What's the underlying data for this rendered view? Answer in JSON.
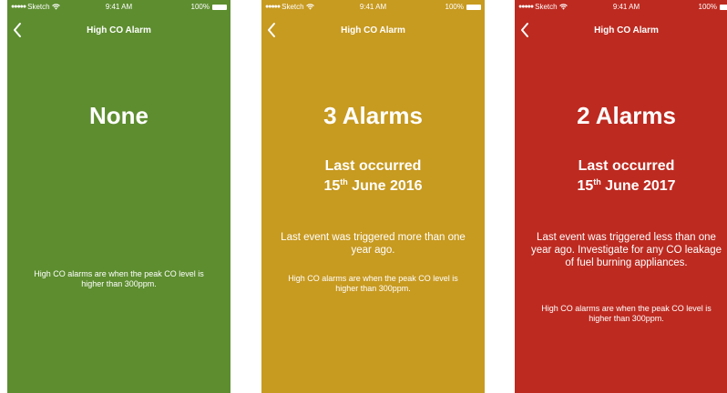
{
  "status_bar": {
    "carrier": "Sketch",
    "signal_dots": "●●●●●",
    "time": "9:41 AM",
    "battery": "100%"
  },
  "screens": [
    {
      "theme_color": "#5d8d2f",
      "nav_title": "High CO Alarm",
      "count_label": "None",
      "info_text": "High CO alarms are  when the peak CO level is higher than 300ppm."
    },
    {
      "theme_color": "#c79a20",
      "nav_title": "High CO Alarm",
      "count_label": "3 Alarms",
      "last_occurred_label": "Last occurred",
      "date_day": "15",
      "date_suffix": "th",
      "date_rest": " June 2016",
      "event_text": "Last event was triggered more than one year ago.",
      "info_text": "High CO alarms are  when the peak CO level is higher than 300ppm."
    },
    {
      "theme_color": "#bd2a20",
      "nav_title": "High CO Alarm",
      "count_label": "2 Alarms",
      "last_occurred_label": "Last occurred",
      "date_day": "15",
      "date_suffix": "th",
      "date_rest": " June 2017",
      "event_text": "Last event was triggered less than one year ago. Investigate for any CO leakage of fuel burning appliances.",
      "info_text": "High CO alarms are  when the peak CO level is higher than 300ppm."
    }
  ],
  "icons": {
    "back": "chevron-left-icon",
    "wifi": "wifi-icon",
    "battery": "battery-icon"
  }
}
